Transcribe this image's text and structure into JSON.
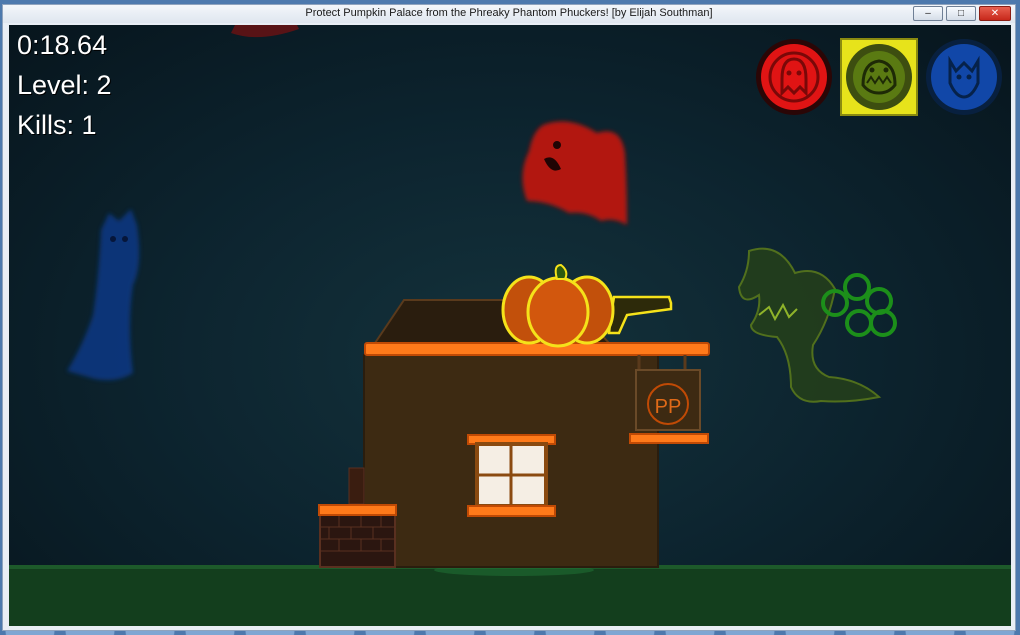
{
  "window": {
    "title": "Protect Pumpkin Palace from the Phreaky Phantom Phuckers! [by Elijah Southman]",
    "buttons": {
      "minimize": "–",
      "maximize": "□",
      "close": "✕"
    }
  },
  "hud": {
    "timer": "0:18.64",
    "level": "Level: 2",
    "kills": "Kills: 1"
  },
  "ghost_selector": [
    {
      "name": "red-ghost-icon",
      "color": "#e01414",
      "selected": false
    },
    {
      "name": "green-ghost-icon",
      "color": "#5a7a12",
      "selected": true
    },
    {
      "name": "blue-ghost-icon",
      "color": "#1147a8",
      "selected": false
    }
  ],
  "sign": {
    "text": "PP"
  },
  "colors": {
    "roof_trim": "#ff7a1a",
    "house": "#3d2a12",
    "pumpkin": "#d2570d",
    "ground": "#123d1c"
  }
}
